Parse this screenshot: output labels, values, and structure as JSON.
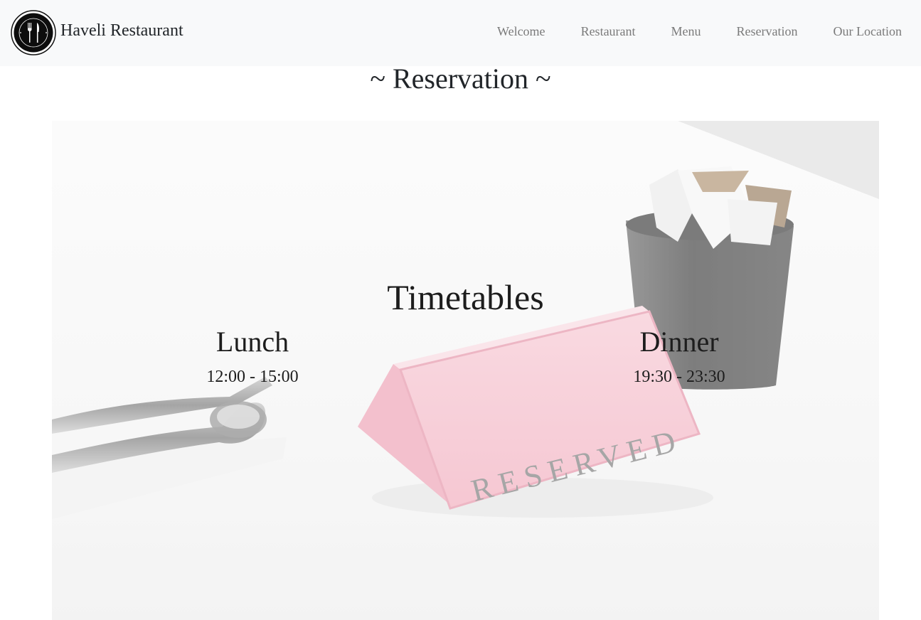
{
  "brand": {
    "name": "Haveli Restaurant",
    "logo_icon": "fork-knife-logo-icon"
  },
  "nav": {
    "items": [
      {
        "label": "Welcome"
      },
      {
        "label": "Restaurant"
      },
      {
        "label": "Menu"
      },
      {
        "label": "Reservation"
      },
      {
        "label": "Our Location"
      }
    ]
  },
  "section": {
    "title": "~ Reservation ~"
  },
  "hero": {
    "sign_text": "RESERVED",
    "timetables_title": "Timetables",
    "lunch": {
      "name": "Lunch",
      "time": "12:00 - 15:00"
    },
    "dinner": {
      "name": "Dinner",
      "time": "19:30 - 23:30"
    }
  },
  "colors": {
    "navbar_bg": "#f8f9fa",
    "nav_link": "#7a7a7a",
    "text": "#212529",
    "sign_pink": "#f2a3b6"
  }
}
